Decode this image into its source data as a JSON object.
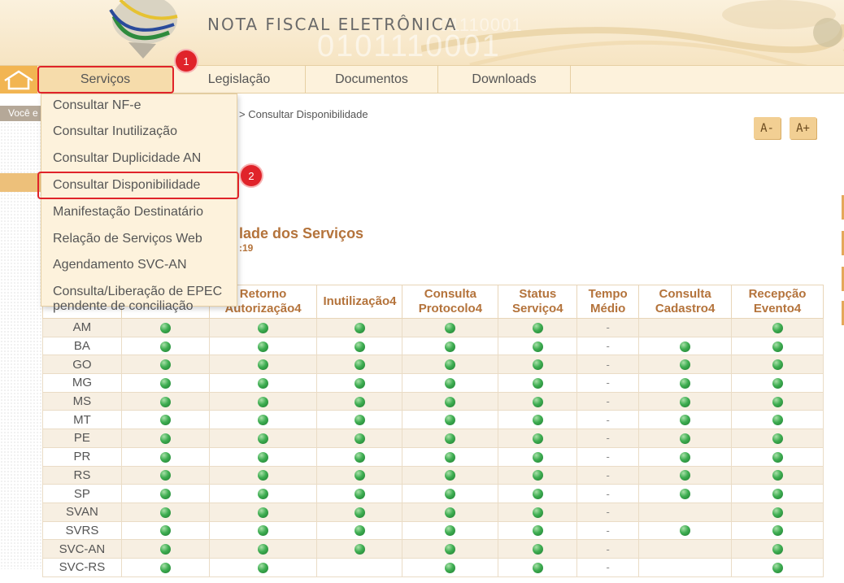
{
  "header": {
    "title": "NOTA FISCAL ELETRÔNICA",
    "decor_binary_1": "0101110001",
    "decor_binary_2": "01110001"
  },
  "nav": {
    "items": [
      {
        "label": "Serviços"
      },
      {
        "label": "Legislação"
      },
      {
        "label": "Documentos"
      },
      {
        "label": "Downloads"
      }
    ]
  },
  "badges": [
    "1",
    "2"
  ],
  "voce_esta": "Você e",
  "breadcrumb": "> Consultar Disponibilidade",
  "font_controls": {
    "decrease": "A-",
    "increase": "A+"
  },
  "section": {
    "title": "lade dos Serviços",
    "subtitle": ":19"
  },
  "dropdown": {
    "items": [
      "Consultar NF-e",
      "Consultar Inutilização",
      "Consultar Duplicidade AN",
      "Consultar Disponibilidade",
      "Manifestação Destinatário",
      "Relação de Serviços Web",
      "Agendamento SVC-AN",
      "Consulta/Liberação de EPEC pendente de conciliação"
    ]
  },
  "table": {
    "headers": [
      "",
      "",
      "Retorno Autorização4",
      "Inutilização4",
      "Consulta Protocolo4",
      "Status Serviço4",
      "Tempo Médio",
      "Consulta Cadastro4",
      "Recepção Evento4"
    ],
    "rows": [
      {
        "uf": "AM",
        "cells": [
          "ok",
          "ok",
          "ok",
          "ok",
          "ok",
          "-",
          "",
          "ok"
        ]
      },
      {
        "uf": "BA",
        "cells": [
          "ok",
          "ok",
          "ok",
          "ok",
          "ok",
          "-",
          "ok",
          "ok"
        ]
      },
      {
        "uf": "GO",
        "cells": [
          "ok",
          "ok",
          "ok",
          "ok",
          "ok",
          "-",
          "ok",
          "ok"
        ]
      },
      {
        "uf": "MG",
        "cells": [
          "ok",
          "ok",
          "ok",
          "ok",
          "ok",
          "-",
          "ok",
          "ok"
        ]
      },
      {
        "uf": "MS",
        "cells": [
          "ok",
          "ok",
          "ok",
          "ok",
          "ok",
          "-",
          "ok",
          "ok"
        ]
      },
      {
        "uf": "MT",
        "cells": [
          "ok",
          "ok",
          "ok",
          "ok",
          "ok",
          "-",
          "ok",
          "ok"
        ]
      },
      {
        "uf": "PE",
        "cells": [
          "ok",
          "ok",
          "ok",
          "ok",
          "ok",
          "-",
          "ok",
          "ok"
        ]
      },
      {
        "uf": "PR",
        "cells": [
          "ok",
          "ok",
          "ok",
          "ok",
          "ok",
          "-",
          "ok",
          "ok"
        ]
      },
      {
        "uf": "RS",
        "cells": [
          "ok",
          "ok",
          "ok",
          "ok",
          "ok",
          "-",
          "ok",
          "ok"
        ]
      },
      {
        "uf": "SP",
        "cells": [
          "ok",
          "ok",
          "ok",
          "ok",
          "ok",
          "-",
          "ok",
          "ok"
        ]
      },
      {
        "uf": "SVAN",
        "cells": [
          "ok",
          "ok",
          "ok",
          "ok",
          "ok",
          "-",
          "",
          "ok"
        ]
      },
      {
        "uf": "SVRS",
        "cells": [
          "ok",
          "ok",
          "ok",
          "ok",
          "ok",
          "-",
          "ok",
          "ok"
        ]
      },
      {
        "uf": "SVC-AN",
        "cells": [
          "ok",
          "ok",
          "ok",
          "ok",
          "ok",
          "-",
          "",
          "ok"
        ]
      },
      {
        "uf": "SVC-RS",
        "cells": [
          "ok",
          "ok",
          "",
          "ok",
          "ok",
          "-",
          "",
          "ok"
        ]
      }
    ]
  },
  "colors": {
    "nav_bg": "#fdf2dc",
    "accent_orange": "#f2b552",
    "heading_brown": "#b4733b",
    "highlight_red": "#e0232a",
    "status_green": "#3fae52"
  }
}
